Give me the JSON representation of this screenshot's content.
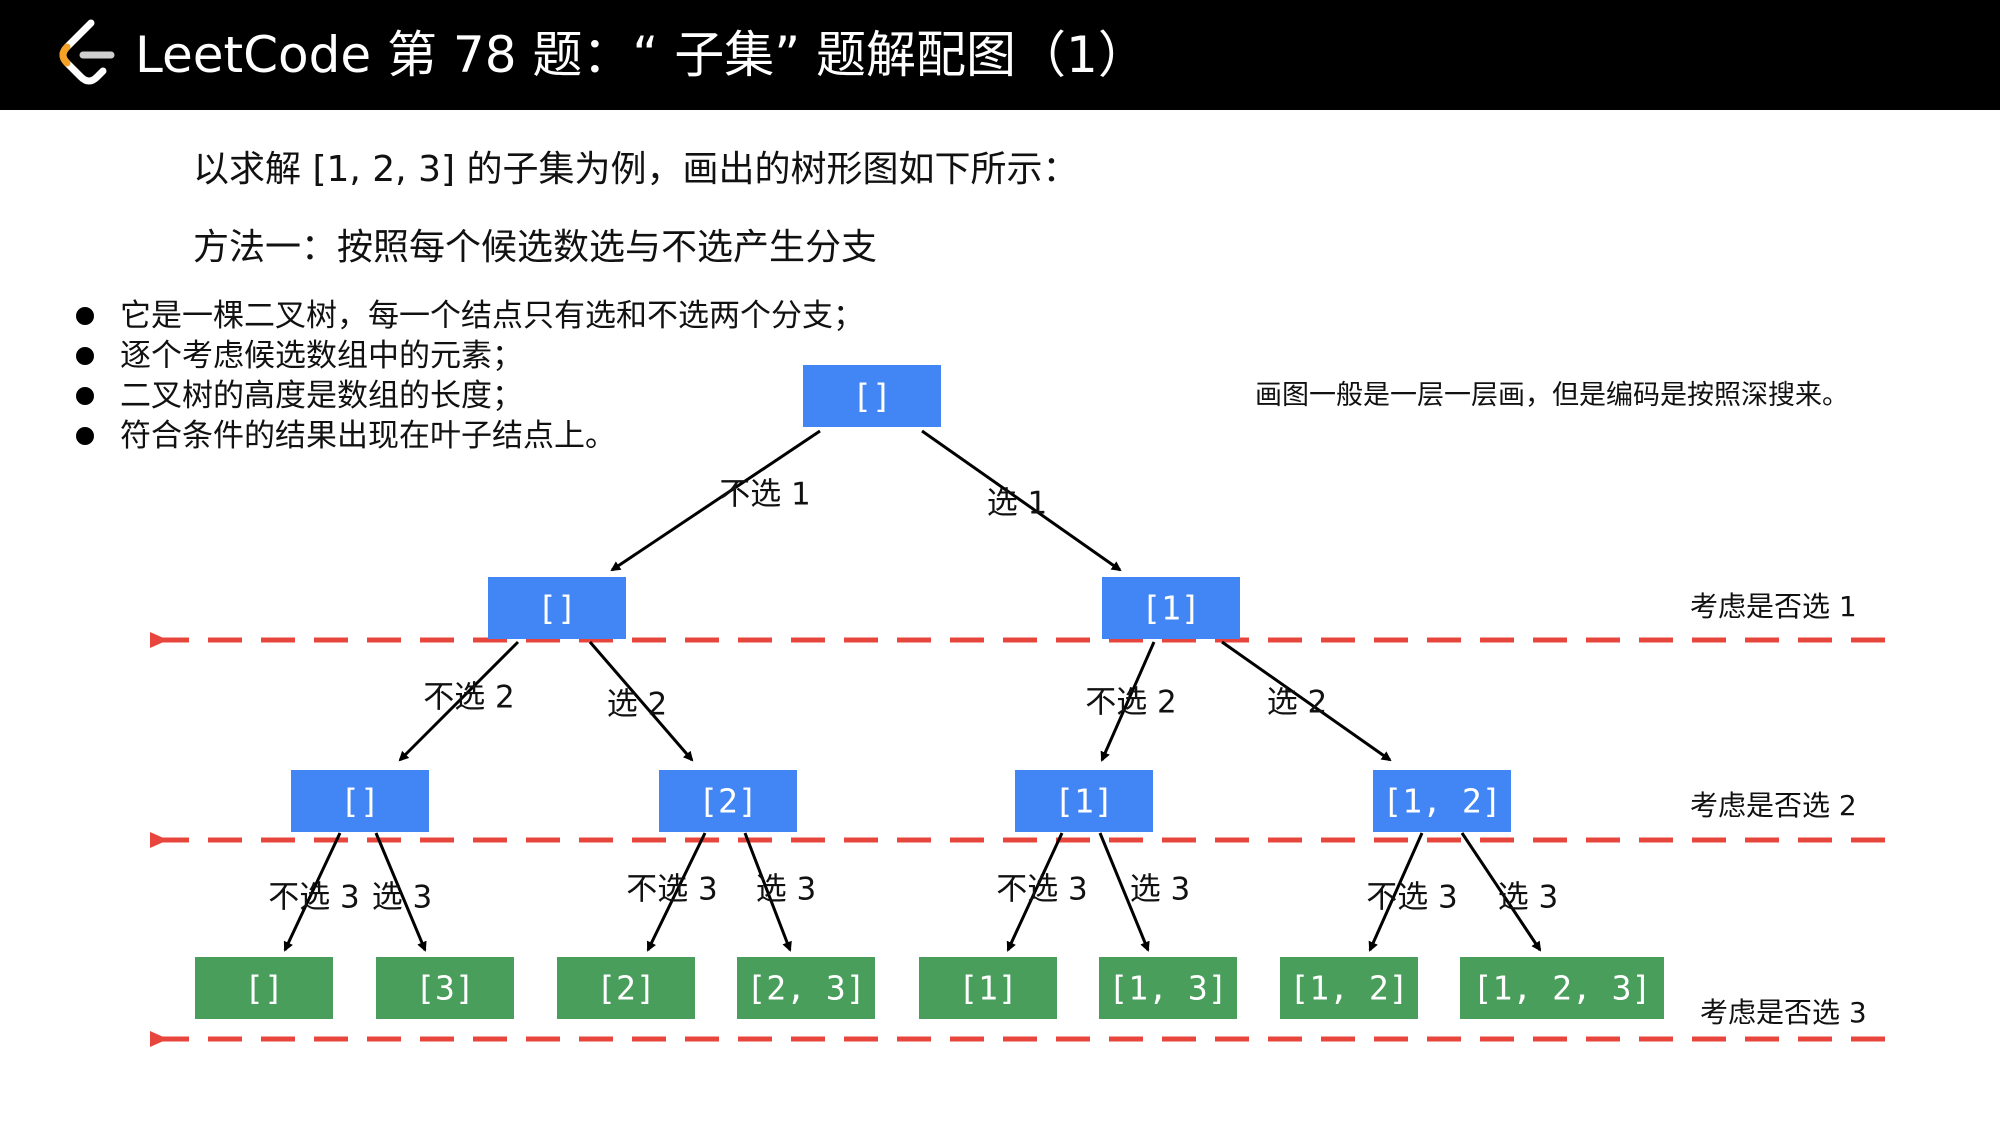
{
  "header": {
    "title": "LeetCode 第 78 题：“ 子集” 题解配图（1）"
  },
  "intro": {
    "line1": "以求解 [1, 2, 3] 的子集为例，画出的树形图如下所示：",
    "line2": "方法一：按照每个候选数选与不选产生分支"
  },
  "bullets": [
    "它是一棵二叉树，每一个结点只有选和不选两个分支；",
    "逐个考虑候选数组中的元素；",
    "二叉树的高度是数组的长度；",
    "符合条件的结果出现在叶子结点上。"
  ],
  "note": "画图一般是一层一层画，但是编码是按照深搜来。",
  "colors": {
    "header_bg": "#000000",
    "node_blue": "#4285f4",
    "node_green": "#4a9e5c",
    "level_line": "#e8453c",
    "logo_orange": "#f4a125"
  },
  "tree": {
    "nodes": [
      {
        "id": "n0",
        "label": "[]",
        "kind": "inner"
      },
      {
        "id": "n00",
        "label": "[]",
        "kind": "inner"
      },
      {
        "id": "n01",
        "label": "[1]",
        "kind": "inner"
      },
      {
        "id": "n000",
        "label": "[]",
        "kind": "inner"
      },
      {
        "id": "n001",
        "label": "[2]",
        "kind": "inner"
      },
      {
        "id": "n010",
        "label": "[1]",
        "kind": "inner"
      },
      {
        "id": "n011",
        "label": "[1, 2]",
        "kind": "inner"
      },
      {
        "id": "l0",
        "label": "[]",
        "kind": "leaf"
      },
      {
        "id": "l1",
        "label": "[3]",
        "kind": "leaf"
      },
      {
        "id": "l2",
        "label": "[2]",
        "kind": "leaf"
      },
      {
        "id": "l3",
        "label": "[2, 3]",
        "kind": "leaf"
      },
      {
        "id": "l4",
        "label": "[1]",
        "kind": "leaf"
      },
      {
        "id": "l5",
        "label": "[1, 3]",
        "kind": "leaf"
      },
      {
        "id": "l6",
        "label": "[1, 2]",
        "kind": "leaf"
      },
      {
        "id": "l7",
        "label": "[1, 2, 3]",
        "kind": "leaf"
      }
    ],
    "edges": [
      {
        "from": "n0",
        "to": "n00",
        "label": "不选 1"
      },
      {
        "from": "n0",
        "to": "n01",
        "label": "选 1"
      },
      {
        "from": "n00",
        "to": "n000",
        "label": "不选 2"
      },
      {
        "from": "n00",
        "to": "n001",
        "label": "选 2"
      },
      {
        "from": "n01",
        "to": "n010",
        "label": "不选 2"
      },
      {
        "from": "n01",
        "to": "n011",
        "label": "选 2"
      },
      {
        "from": "n000",
        "to": "l0",
        "label": "不选 3"
      },
      {
        "from": "n000",
        "to": "l1",
        "label": "选 3"
      },
      {
        "from": "n001",
        "to": "l2",
        "label": "不选 3"
      },
      {
        "from": "n001",
        "to": "l3",
        "label": "选 3"
      },
      {
        "from": "n010",
        "to": "l4",
        "label": "不选 3"
      },
      {
        "from": "n010",
        "to": "l5",
        "label": "选 3"
      },
      {
        "from": "n011",
        "to": "l6",
        "label": "不选 3"
      },
      {
        "from": "n011",
        "to": "l7",
        "label": "选 3"
      }
    ],
    "levels": [
      "考虑是否选 1",
      "考虑是否选 2",
      "考虑是否选 3"
    ]
  }
}
